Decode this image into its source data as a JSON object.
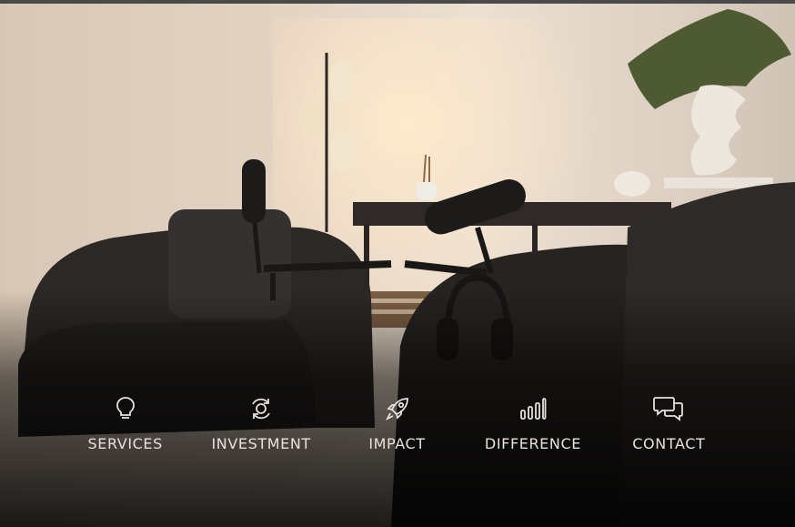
{
  "nav": {
    "items": [
      {
        "label": "SERVICES",
        "icon": "lightbulb-icon"
      },
      {
        "label": "INVESTMENT",
        "icon": "refresh-cycle-icon"
      },
      {
        "label": "IMPACT",
        "icon": "rocket-icon"
      },
      {
        "label": "DIFFERENCE",
        "icon": "bar-chart-icon"
      },
      {
        "label": "CONTACT",
        "icon": "chat-bubbles-icon"
      }
    ]
  },
  "colors": {
    "nav_text": "#e6e1dc",
    "wall": "#e3d3c2",
    "chair": "#2b2826"
  }
}
